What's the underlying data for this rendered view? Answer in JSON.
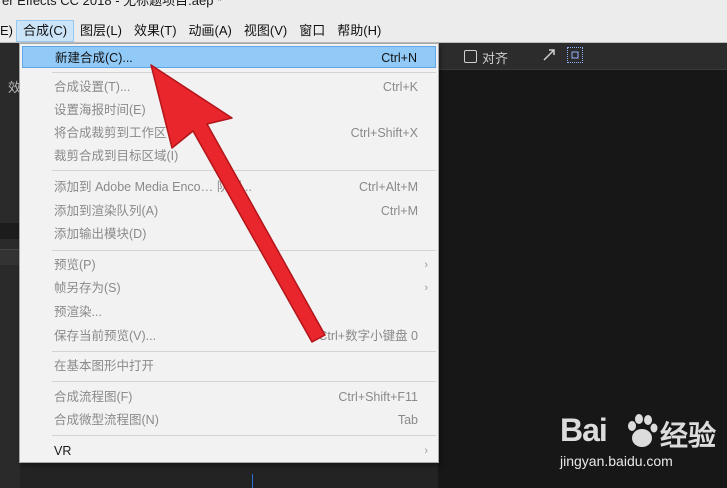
{
  "window": {
    "title": "er Effects CC 2018 - 无标题项目.aep *"
  },
  "menubar": {
    "items": [
      "E)",
      "合成(C)",
      "图层(L)",
      "效果(T)",
      "动画(A)",
      "视图(V)",
      "窗口",
      "帮助(H)"
    ],
    "active_index": 1
  },
  "toolbar": {
    "align_label": "对齐",
    "snap_icon": "snap-arrow-icon",
    "fit_icon": "fit-frame-icon"
  },
  "left_panel": {
    "char": "效"
  },
  "menu": {
    "items": [
      {
        "label": "新建合成(C)...",
        "shortcut": "Ctrl+N",
        "state": "highlight"
      },
      {
        "label": "合成设置(T)...",
        "shortcut": "Ctrl+K",
        "state": "disabled"
      },
      {
        "label": "设置海报时间(E)",
        "shortcut": "",
        "state": "disabled"
      },
      {
        "label": "将合成裁剪到工作区",
        "shortcut": "Ctrl+Shift+X",
        "state": "disabled"
      },
      {
        "label": "裁剪合成到目标区域(I)",
        "shortcut": "",
        "state": "disabled"
      },
      {
        "label": "添加到 Adobe Media Enco… 队列...",
        "shortcut": "Ctrl+Alt+M",
        "state": "disabled"
      },
      {
        "label": "添加到渲染队列(A)",
        "shortcut": "Ctrl+M",
        "state": "disabled"
      },
      {
        "label": "添加输出模块(D)",
        "shortcut": "",
        "state": "disabled"
      },
      {
        "label": "预览(P)",
        "shortcut": "",
        "state": "disabled",
        "submenu": true
      },
      {
        "label": "帧另存为(S)",
        "shortcut": "",
        "state": "disabled",
        "submenu": true
      },
      {
        "label": "预渲染...",
        "shortcut": "",
        "state": "disabled"
      },
      {
        "label": "保存当前预览(V)...",
        "shortcut": "Ctrl+数字小键盘 0",
        "state": "disabled"
      },
      {
        "label": "在基本图形中打开",
        "shortcut": "",
        "state": "disabled"
      },
      {
        "label": "合成流程图(F)",
        "shortcut": "Ctrl+Shift+F11",
        "state": "disabled"
      },
      {
        "label": "合成微型流程图(N)",
        "shortcut": "Tab",
        "state": "disabled"
      },
      {
        "label": "VR",
        "shortcut": "",
        "state": "enabled",
        "submenu": true
      }
    ],
    "submenu_glyph": "›"
  },
  "watermark": {
    "logo_text": "Bai",
    "logo_text_2": "经验",
    "site": "jingyan.baidu.com"
  },
  "colors": {
    "highlight": "#91c9f7",
    "arrow": "#e8262b",
    "menubar_active": "#cce4f7"
  }
}
